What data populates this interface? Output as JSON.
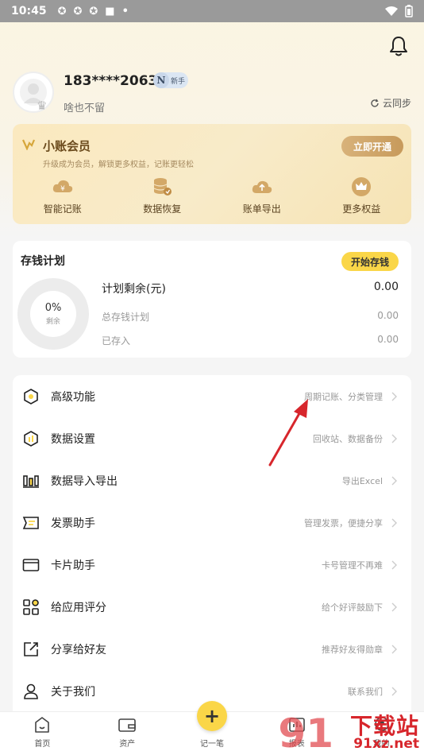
{
  "status_bar": {
    "time": "10:45"
  },
  "profile": {
    "phone": "183****2063",
    "badge_letter": "N",
    "badge_text": "新手",
    "motto": "啥也不留",
    "sync_label": "云同步"
  },
  "vip": {
    "title": "小账会员",
    "subtitle": "升级成为会员，解锁更多权益，记账更轻松",
    "button": "立即开通",
    "items": [
      {
        "label": "智能记账",
        "icon": "smart-bookkeeping-icon"
      },
      {
        "label": "数据恢复",
        "icon": "data-restore-icon"
      },
      {
        "label": "账单导出",
        "icon": "bill-export-icon"
      },
      {
        "label": "更多权益",
        "icon": "more-benefits-icon"
      }
    ]
  },
  "savings_plan": {
    "title": "存钱计划",
    "button": "开始存钱",
    "percent": "0%",
    "percent_label": "剩余",
    "remaining_label": "计划剩余(元)",
    "remaining_value": "0.00",
    "total_label": "总存钱计划",
    "total_value": "0.00",
    "saved_label": "已存入",
    "saved_value": "0.00"
  },
  "menu": [
    {
      "label": "高级功能",
      "hint": "周期记账、分类管理",
      "icon": "hexagon-icon"
    },
    {
      "label": "数据设置",
      "hint": "回收站、数据备份",
      "icon": "data-settings-icon"
    },
    {
      "label": "数据导入导出",
      "hint": "导出Excel",
      "icon": "bar-chart-icon"
    },
    {
      "label": "发票助手",
      "hint": "管理发票，便捷分享",
      "icon": "invoice-icon"
    },
    {
      "label": "卡片助手",
      "hint": "卡号管理不再难",
      "icon": "card-icon"
    },
    {
      "label": "给应用评分",
      "hint": "给个好评鼓励下",
      "icon": "grid-icon"
    },
    {
      "label": "分享给好友",
      "hint": "推荐好友得勋章",
      "icon": "share-icon"
    },
    {
      "label": "关于我们",
      "hint": "联系我们",
      "icon": "user-icon"
    }
  ],
  "bottom_nav": {
    "home": "首页",
    "assets": "资产",
    "record": "记一笔",
    "reports": "报表",
    "mine": "我的"
  },
  "watermark": {
    "text": "下载站",
    "url": "91xz.net",
    "logo": "91"
  },
  "colors": {
    "accent": "#fad648",
    "annotation": "#d7262c"
  }
}
